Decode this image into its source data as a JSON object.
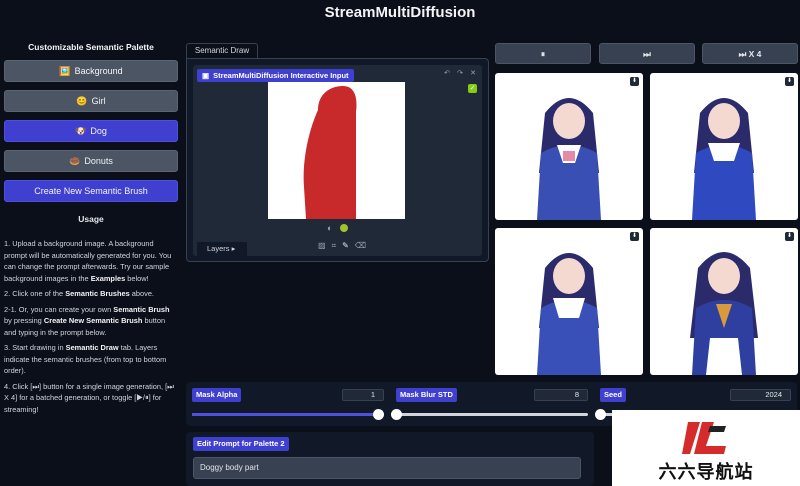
{
  "app": {
    "title": "StreamMultiDiffusion"
  },
  "palette": {
    "title": "Customizable Semantic Palette",
    "brushes": [
      {
        "emoji": "🖼️",
        "label": "Background"
      },
      {
        "emoji": "😊",
        "label": "Girl"
      },
      {
        "emoji": "🐶",
        "label": "Dog"
      },
      {
        "emoji": "🍩",
        "label": "Donuts"
      }
    ],
    "create_label": "Create New Semantic Brush"
  },
  "usage": {
    "title": "Usage",
    "step1": "1. Upload a background image. A background prompt will be automatically generated for you. You can change the prompt afterwards. Try our sample background images in the",
    "step1_bold": "Examples",
    "step1_end": "below!",
    "step2": "2. Click one of the",
    "step2_bold": "Semantic Brushes",
    "step2_end": "above.",
    "step21": "2-1. Or, you can create your own",
    "step21_bold1": "Semantic Brush",
    "step21_mid": "by pressing",
    "step21_bold2": "Create New Semantic Brush",
    "step21_end": "button and typing in the prompt below.",
    "step3": "3. Start drawing in",
    "step3_bold": "Semantic Draw",
    "step3_end": "tab. Layers indicate the semantic brushes (from top to bottom order).",
    "step4": "4. Click [⏭] button for a single image generation, [⏭ X 4] for a batched generation, or toggle [▶/⏸] for streaming!"
  },
  "draw": {
    "tab_label": "Semantic Draw",
    "canvas_label": "StreamMultiDiffusion Interactive Input",
    "layers_label": "Layers ▸",
    "brush_color": "#c8292b"
  },
  "controls": {
    "stream_label": "⏸",
    "single_label": "⏭",
    "batch_label": "⏭ X 4"
  },
  "sliders": {
    "mask_alpha": {
      "label": "Mask Alpha",
      "value": "1",
      "fraction": 1.0
    },
    "mask_blur": {
      "label": "Mask Blur STD",
      "value": "8",
      "fraction": 0.0
    },
    "seed": {
      "label": "Seed",
      "value": "2024",
      "fraction": 0.0
    }
  },
  "prompt": {
    "label": "Edit Prompt for Palette 2",
    "value": "Doggy body part"
  },
  "watermark": {
    "text": "六六导航站"
  }
}
